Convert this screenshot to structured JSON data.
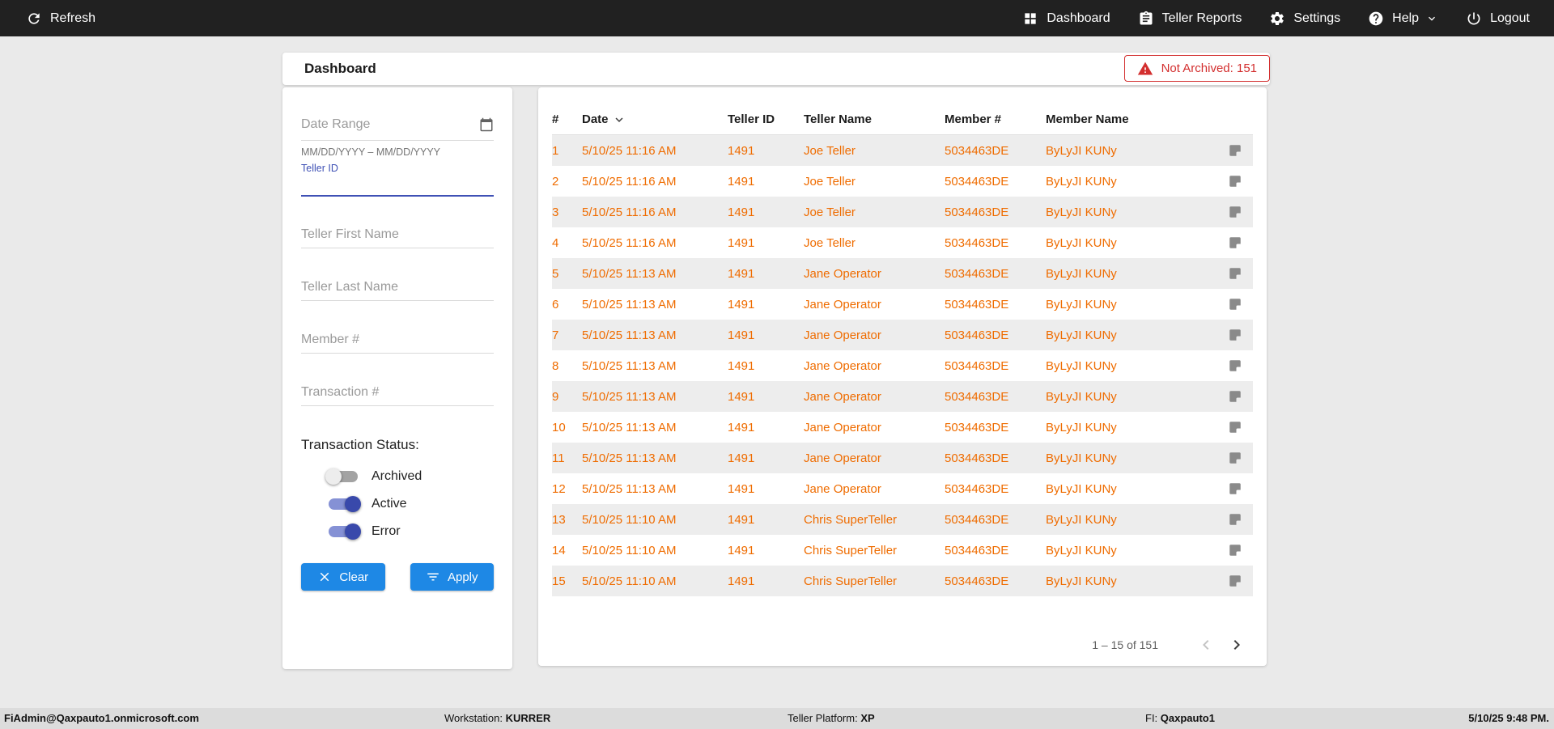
{
  "colors": {
    "navbar_bg": "#212121",
    "page_bg": "#eaeaea",
    "accent_blue": "#1e88e5",
    "toggle_on_blue": "#3949ab",
    "row_text_orange": "#ef6c00",
    "badge_red": "#d32f2f"
  },
  "navbar": {
    "refresh_label": "Refresh",
    "items": [
      {
        "label": "Dashboard"
      },
      {
        "label": "Teller Reports"
      },
      {
        "label": "Settings"
      },
      {
        "label": "Help"
      },
      {
        "label": "Logout"
      }
    ]
  },
  "header": {
    "title": "Dashboard",
    "not_archived_label": "Not Archived: 151"
  },
  "filters": {
    "date_range_placeholder": "Date Range",
    "date_range_hint": "MM/DD/YYYY – MM/DD/YYYY",
    "teller_id_label": "Teller ID",
    "teller_first_name_placeholder": "Teller First Name",
    "teller_last_name_placeholder": "Teller Last Name",
    "member_placeholder": "Member #",
    "transaction_placeholder": "Transaction #",
    "status_label": "Transaction Status:",
    "toggles": [
      {
        "label": "Archived",
        "on": false
      },
      {
        "label": "Active",
        "on": true
      },
      {
        "label": "Error",
        "on": true
      }
    ],
    "clear_label": "Clear",
    "apply_label": "Apply"
  },
  "table": {
    "columns": [
      "#",
      "Date",
      "Teller ID",
      "Teller Name",
      "Member #",
      "Member Name"
    ],
    "rows": [
      {
        "num": "1",
        "date": "5/10/25 11:16 AM",
        "teller_id": "1491",
        "teller_name": "Joe Teller",
        "member_num": "5034463DE",
        "member_name": "ByLyJI KUNy"
      },
      {
        "num": "2",
        "date": "5/10/25 11:16 AM",
        "teller_id": "1491",
        "teller_name": "Joe Teller",
        "member_num": "5034463DE",
        "member_name": "ByLyJI KUNy"
      },
      {
        "num": "3",
        "date": "5/10/25 11:16 AM",
        "teller_id": "1491",
        "teller_name": "Joe Teller",
        "member_num": "5034463DE",
        "member_name": "ByLyJI KUNy"
      },
      {
        "num": "4",
        "date": "5/10/25 11:16 AM",
        "teller_id": "1491",
        "teller_name": "Joe Teller",
        "member_num": "5034463DE",
        "member_name": "ByLyJI KUNy"
      },
      {
        "num": "5",
        "date": "5/10/25 11:13 AM",
        "teller_id": "1491",
        "teller_name": "Jane Operator",
        "member_num": "5034463DE",
        "member_name": "ByLyJI KUNy"
      },
      {
        "num": "6",
        "date": "5/10/25 11:13 AM",
        "teller_id": "1491",
        "teller_name": "Jane Operator",
        "member_num": "5034463DE",
        "member_name": "ByLyJI KUNy"
      },
      {
        "num": "7",
        "date": "5/10/25 11:13 AM",
        "teller_id": "1491",
        "teller_name": "Jane Operator",
        "member_num": "5034463DE",
        "member_name": "ByLyJI KUNy"
      },
      {
        "num": "8",
        "date": "5/10/25 11:13 AM",
        "teller_id": "1491",
        "teller_name": "Jane Operator",
        "member_num": "5034463DE",
        "member_name": "ByLyJI KUNy"
      },
      {
        "num": "9",
        "date": "5/10/25 11:13 AM",
        "teller_id": "1491",
        "teller_name": "Jane Operator",
        "member_num": "5034463DE",
        "member_name": "ByLyJI KUNy"
      },
      {
        "num": "10",
        "date": "5/10/25 11:13 AM",
        "teller_id": "1491",
        "teller_name": "Jane Operator",
        "member_num": "5034463DE",
        "member_name": "ByLyJI KUNy"
      },
      {
        "num": "11",
        "date": "5/10/25 11:13 AM",
        "teller_id": "1491",
        "teller_name": "Jane Operator",
        "member_num": "5034463DE",
        "member_name": "ByLyJI KUNy"
      },
      {
        "num": "12",
        "date": "5/10/25 11:13 AM",
        "teller_id": "1491",
        "teller_name": "Jane Operator",
        "member_num": "5034463DE",
        "member_name": "ByLyJI KUNy"
      },
      {
        "num": "13",
        "date": "5/10/25 11:10 AM",
        "teller_id": "1491",
        "teller_name": "Chris SuperTeller",
        "member_num": "5034463DE",
        "member_name": "ByLyJI KUNy"
      },
      {
        "num": "14",
        "date": "5/10/25 11:10 AM",
        "teller_id": "1491",
        "teller_name": "Chris SuperTeller",
        "member_num": "5034463DE",
        "member_name": "ByLyJI KUNy"
      },
      {
        "num": "15",
        "date": "5/10/25 11:10 AM",
        "teller_id": "1491",
        "teller_name": "Chris SuperTeller",
        "member_num": "5034463DE",
        "member_name": "ByLyJI KUNy"
      }
    ],
    "pagination_range": "1 – 15 of 151"
  },
  "footer": {
    "user": "FiAdmin@Qaxpauto1.onmicrosoft.com",
    "workstation_label": "Workstation:",
    "workstation_value": "KURRER",
    "platform_label": "Teller Platform:",
    "platform_value": "XP",
    "fi_label": "FI:",
    "fi_value": "Qaxpauto1",
    "datetime": "5/10/25 9:48 PM."
  }
}
